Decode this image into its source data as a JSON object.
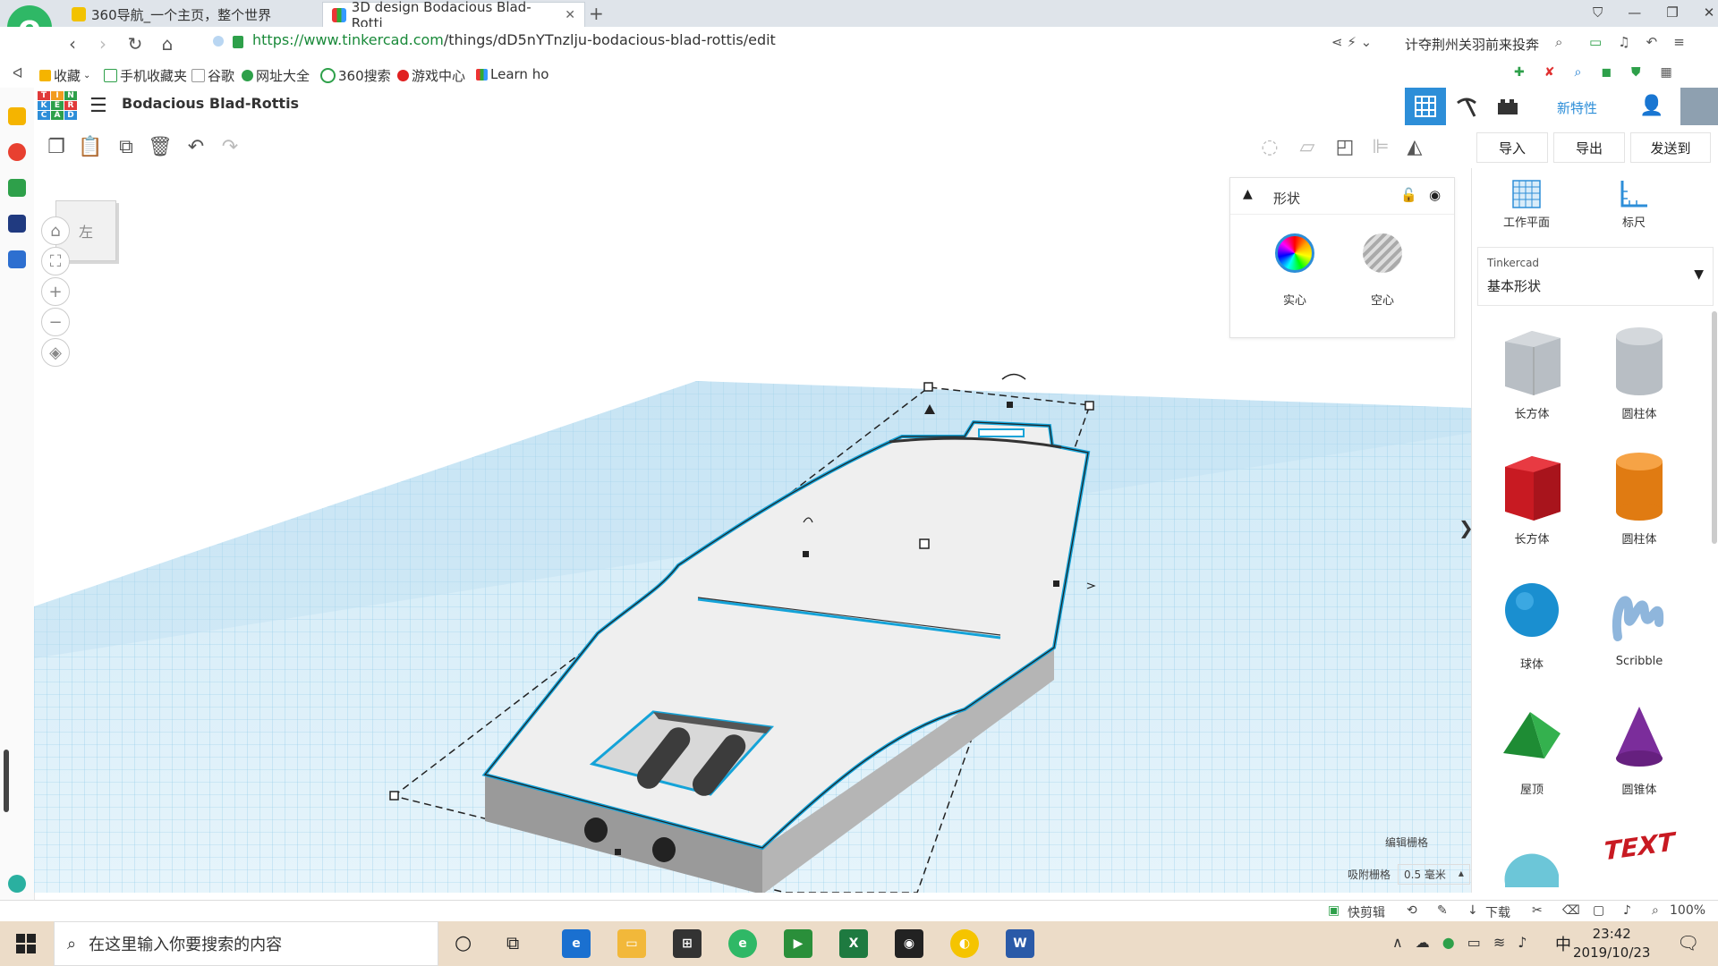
{
  "browser": {
    "tabs": [
      {
        "label": "360导航_一个主页，整个世界",
        "active": false
      },
      {
        "label": "3D design Bodacious Blad-Rotti",
        "active": true
      }
    ],
    "new_tab": "+",
    "url_prefix": "https://www.tinkercad.com",
    "url_path": "/things/dD5nYTnzlju-bodacious-blad-rottis/edit",
    "news_ticker": "计夺荆州关羽前来投奔",
    "bookmarks": [
      "收藏",
      "手机收藏夹",
      "谷歌",
      "网址大全",
      "360搜索",
      "游戏中心",
      "Learn ho"
    ]
  },
  "app": {
    "logo_letters": [
      "T",
      "I",
      "N",
      "K",
      "E",
      "R",
      "C",
      "A",
      "D"
    ],
    "design_title": "Bodacious Blad-Rottis",
    "new_features": "新特性",
    "toolbar": {
      "import": "导入",
      "export": "导出",
      "send_to": "发送到"
    }
  },
  "workplane": {
    "viewcube_label": "左",
    "edit_grid": "编辑栅格",
    "snap_label": "吸附栅格",
    "snap_value": "0.5 毫米"
  },
  "inspector": {
    "title": "形状",
    "solid": "实心",
    "hole": "空心"
  },
  "panel": {
    "workplane_tool": "工作平面",
    "ruler_tool": "标尺",
    "library_source": "Tinkercad",
    "library_name": "基本形状",
    "shapes": [
      {
        "label": "长方体",
        "color": "#b0b6bc"
      },
      {
        "label": "圆柱体",
        "color": "#b0b6bc"
      },
      {
        "label": "长方体",
        "color": "#d0202a"
      },
      {
        "label": "圆柱体",
        "color": "#e8851a"
      },
      {
        "label": "球体",
        "color": "#1a8fd0"
      },
      {
        "label": "Scribble",
        "color": "#8fb6dc"
      },
      {
        "label": "屋顶",
        "color": "#2aa640"
      },
      {
        "label": "圆锥体",
        "color": "#7b2d9b"
      }
    ],
    "text_shape": "TEXT"
  },
  "statusbar": {
    "quick_clip": "快剪辑",
    "download": "下载",
    "zoom": "100%"
  },
  "taskbar": {
    "search_placeholder": "在这里输入你要搜索的内容",
    "time": "23:42",
    "date": "2019/10/23",
    "ime": "中"
  }
}
